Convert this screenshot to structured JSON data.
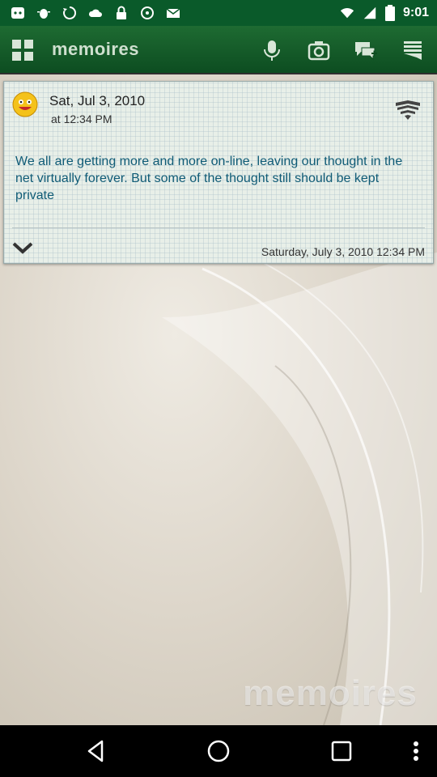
{
  "status_bar": {
    "time": "9:01"
  },
  "toolbar": {
    "title": "memoires"
  },
  "entry": {
    "date": "Sat, Jul 3, 2010",
    "time": "at 12:34 PM",
    "text": "We all are getting more and more on-line, leaving our thought in the net virtually forever. But some of the thought still should be kept private",
    "footer_timestamp": "Saturday, July 3, 2010 12:34 PM"
  },
  "watermark": "memoires",
  "colors": {
    "toolbar_green": "#0d4d21",
    "note_text": "#0f5b76"
  }
}
